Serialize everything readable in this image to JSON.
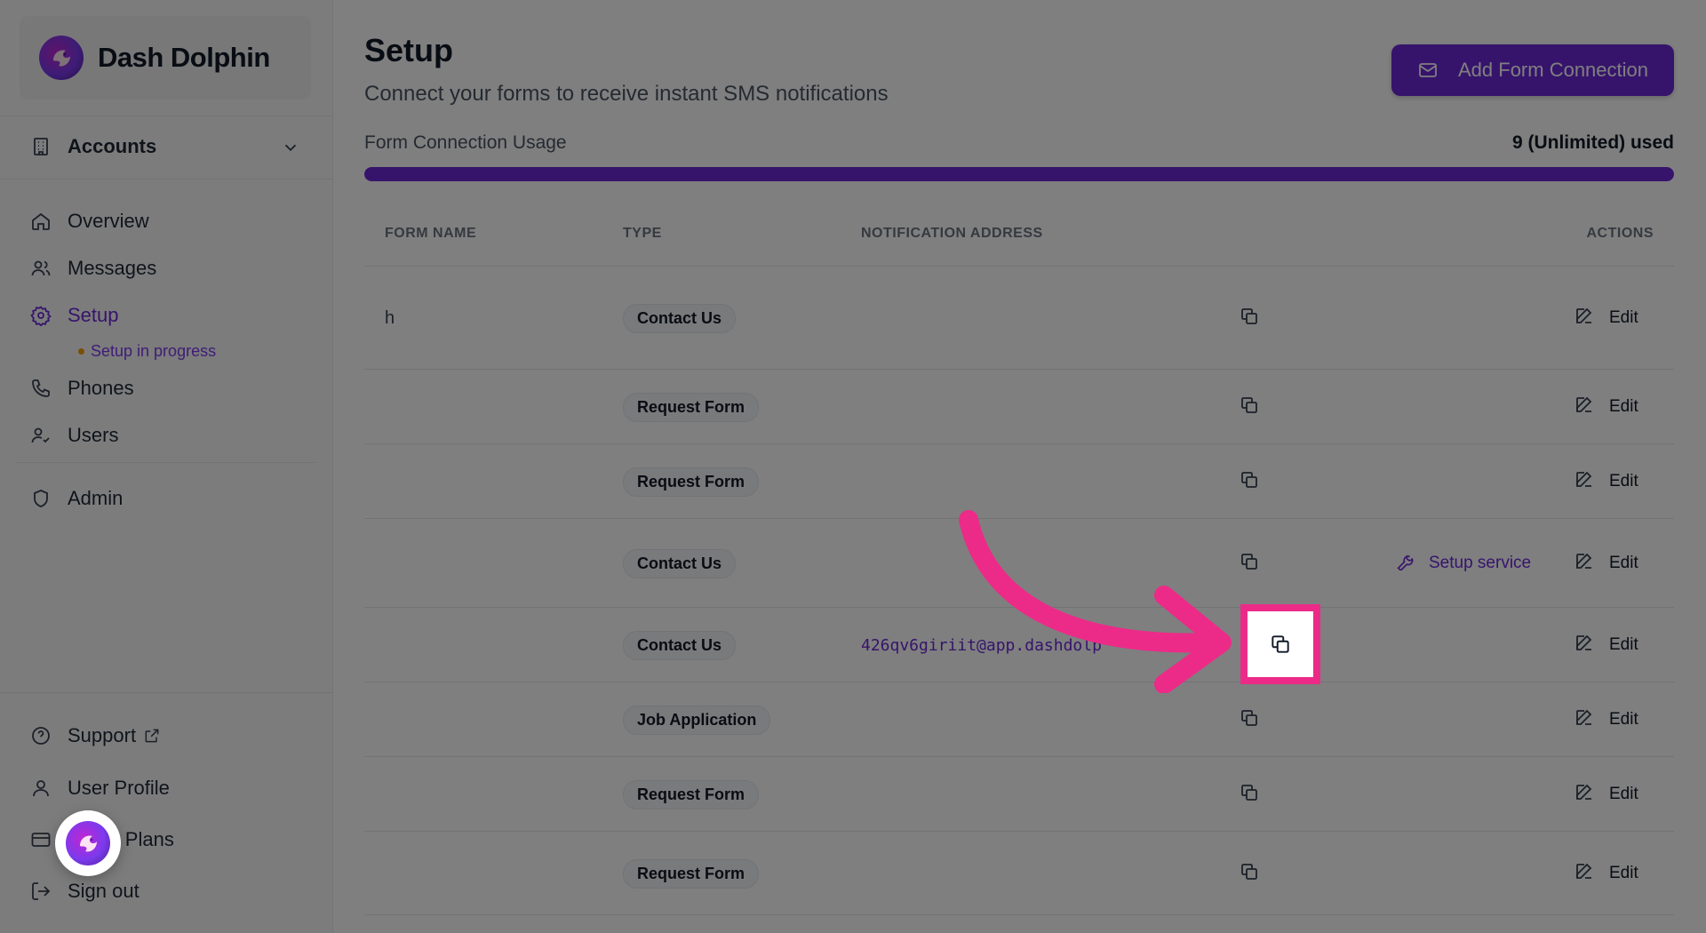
{
  "brand": {
    "name": "Dash Dolphin"
  },
  "sidebar": {
    "accounts_label": "Accounts",
    "items": [
      {
        "label": "Overview",
        "icon": "home-icon"
      },
      {
        "label": "Messages",
        "icon": "users-icon"
      },
      {
        "label": "Setup",
        "icon": "gear-icon",
        "active": true
      },
      {
        "label": "Phones",
        "icon": "phone-icon"
      },
      {
        "label": "Users",
        "icon": "user-check-icon"
      },
      {
        "label": "Admin",
        "icon": "shield-icon"
      }
    ],
    "setup_status": "Setup in progress",
    "footer": [
      {
        "label": "Support",
        "icon": "help-circle-icon"
      },
      {
        "label": "User Profile",
        "icon": "user-icon"
      },
      {
        "label": "& Plans",
        "icon": "credit-card-icon"
      },
      {
        "label": "Sign out",
        "icon": "sign-out-icon"
      }
    ]
  },
  "page": {
    "title": "Setup",
    "subtitle": "Connect your forms to receive instant SMS notifications",
    "add_button": "Add Form Connection",
    "usage_label": "Form Connection Usage",
    "usage_value": "9 (Unlimited) used",
    "usage_fraction": 1.0
  },
  "table": {
    "headers": {
      "name": "FORM NAME",
      "type": "TYPE",
      "address": "NOTIFICATION ADDRESS",
      "actions": "ACTIONS"
    },
    "rows": [
      {
        "name": "h",
        "type": "Contact Us",
        "address": "",
        "status": "",
        "service": "",
        "edit": "Edit"
      },
      {
        "name": "",
        "type": "Request Form",
        "address": "",
        "status": "",
        "service": "",
        "edit": "Edit"
      },
      {
        "name": "",
        "type": "Request Form",
        "address": "",
        "status": "",
        "service": "",
        "edit": "Edit"
      },
      {
        "name": "",
        "type": "Contact Us",
        "address": "",
        "status": "",
        "service": "Setup service",
        "edit": "Edit"
      },
      {
        "name": "",
        "type": "Contact Us",
        "address": "426qv6giriit@app.dashdolp",
        "status": "",
        "service": "",
        "edit": "Edit"
      },
      {
        "name": "",
        "type": "Job Application",
        "address": "",
        "status": "",
        "service": "",
        "edit": "Edit"
      },
      {
        "name": "",
        "type": "Request Form",
        "address": "",
        "status": "",
        "service": "",
        "edit": "Edit"
      },
      {
        "name": "",
        "type": "Request Form",
        "address": "",
        "status": "",
        "service": "",
        "edit": "Edit"
      }
    ]
  },
  "colors": {
    "accent": "#6d28d9",
    "highlight": "#ec2b88",
    "pending": "#f59e0b"
  }
}
